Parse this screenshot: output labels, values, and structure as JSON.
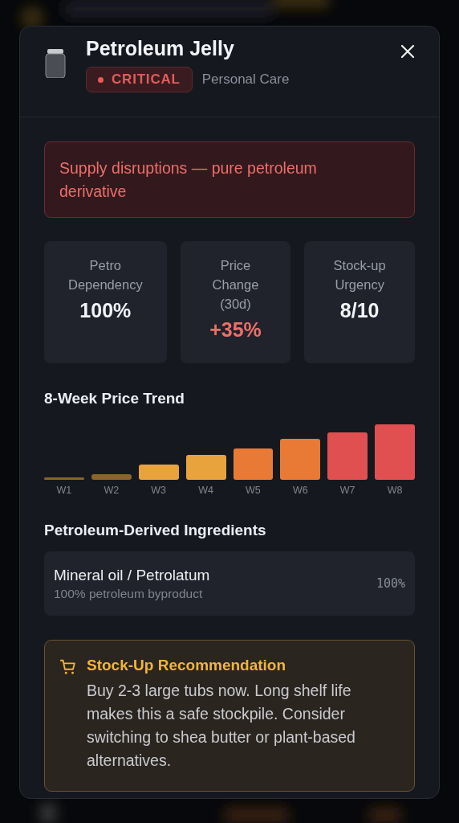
{
  "product": {
    "name": "Petroleum Jelly",
    "severity": "CRITICAL",
    "category": "Personal Care"
  },
  "alert": "Supply disruptions — pure petroleum derivative",
  "stats": [
    {
      "label": "Petro Dependency",
      "value": "100%",
      "kind": "neutral"
    },
    {
      "label": "Price Change (30d)",
      "value": "+35%",
      "kind": "rise"
    },
    {
      "label": "Stock-up Urgency",
      "value": "8/10",
      "kind": "neutral"
    }
  ],
  "trend": {
    "title": "8-Week Price Trend",
    "weeks": [
      "W1",
      "W2",
      "W3",
      "W4",
      "W5",
      "W6",
      "W7",
      "W8"
    ]
  },
  "ingredients": {
    "title": "Petroleum-Derived Ingredients",
    "items": [
      {
        "name": "Mineral oil / Petrolatum",
        "note": "100% petroleum byproduct",
        "share": "100%"
      }
    ]
  },
  "recommendation": {
    "title": "Stock-Up Recommendation",
    "text": "Buy 2-3 large tubs now. Long shelf life makes this a safe stockpile. Consider switching to shea butter or plant-based alternatives."
  }
}
